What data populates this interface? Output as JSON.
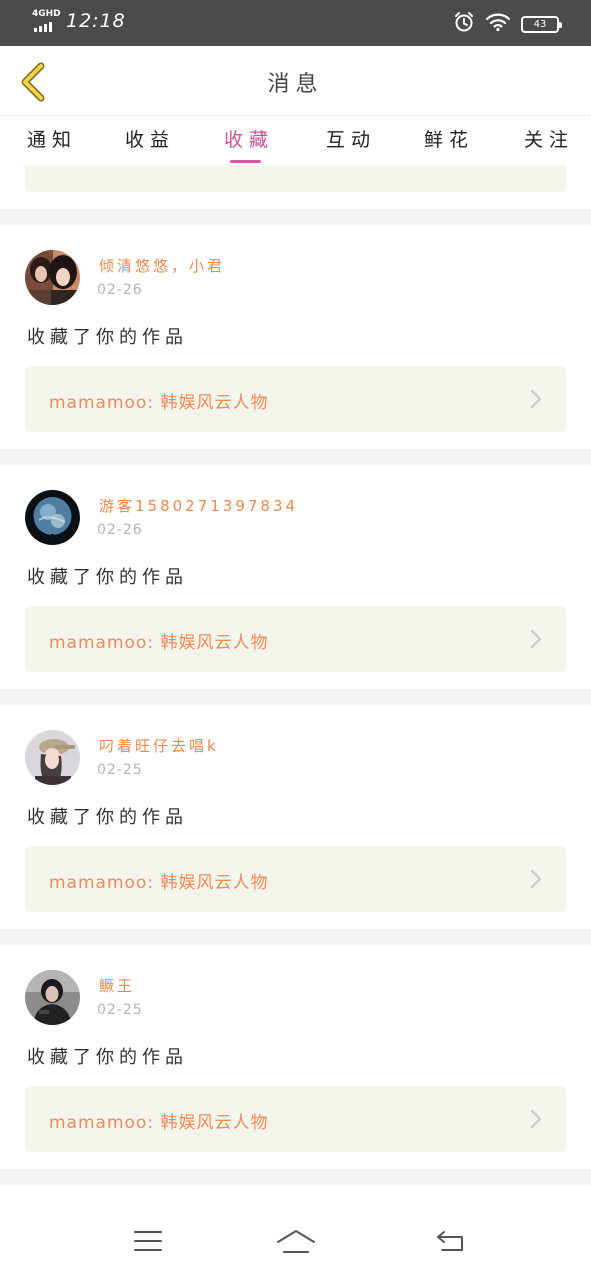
{
  "status_bar": {
    "network": "4GHD",
    "time": "12:18",
    "battery": "43",
    "icons": [
      "signal-icon",
      "alarm-icon",
      "wifi-icon",
      "battery-icon"
    ]
  },
  "header": {
    "title": "消息",
    "back_icon": "chevron-left-icon"
  },
  "tabs": [
    {
      "label": "通知",
      "active": false
    },
    {
      "label": "收益",
      "active": false
    },
    {
      "label": "收藏",
      "active": true
    },
    {
      "label": "互动",
      "active": false
    },
    {
      "label": "鲜花",
      "active": false
    },
    {
      "label": "关注",
      "active": false
    }
  ],
  "messages": [
    {
      "name": "倾清悠悠，小君",
      "date": "02-26",
      "action": "收藏了你的作品",
      "work": "mamamoo:  韩娱风云人物",
      "avatar": "two-girls"
    },
    {
      "name": "游客1580271397834",
      "date": "02-26",
      "action": "收藏了你的作品",
      "work": "mamamoo:  韩娱风云人物",
      "avatar": "earth"
    },
    {
      "name": "叼着旺仔去唱k",
      "date": "02-25",
      "action": "收藏了你的作品",
      "work": "mamamoo:  韩娱风云人物",
      "avatar": "girl-cap"
    },
    {
      "name": "鳜王",
      "date": "02-25",
      "action": "收藏了你的作品",
      "work": "mamamoo:  韩娱风云人物",
      "avatar": "girl-dark"
    }
  ],
  "bottom_nav": [
    "menu-icon",
    "home-icon",
    "back-icon"
  ],
  "colors": {
    "accent_pink": "#c8549a",
    "name_orange": "#e58a50",
    "card_bg": "#f5f4ed",
    "status_bar": "#4b4b4b"
  }
}
